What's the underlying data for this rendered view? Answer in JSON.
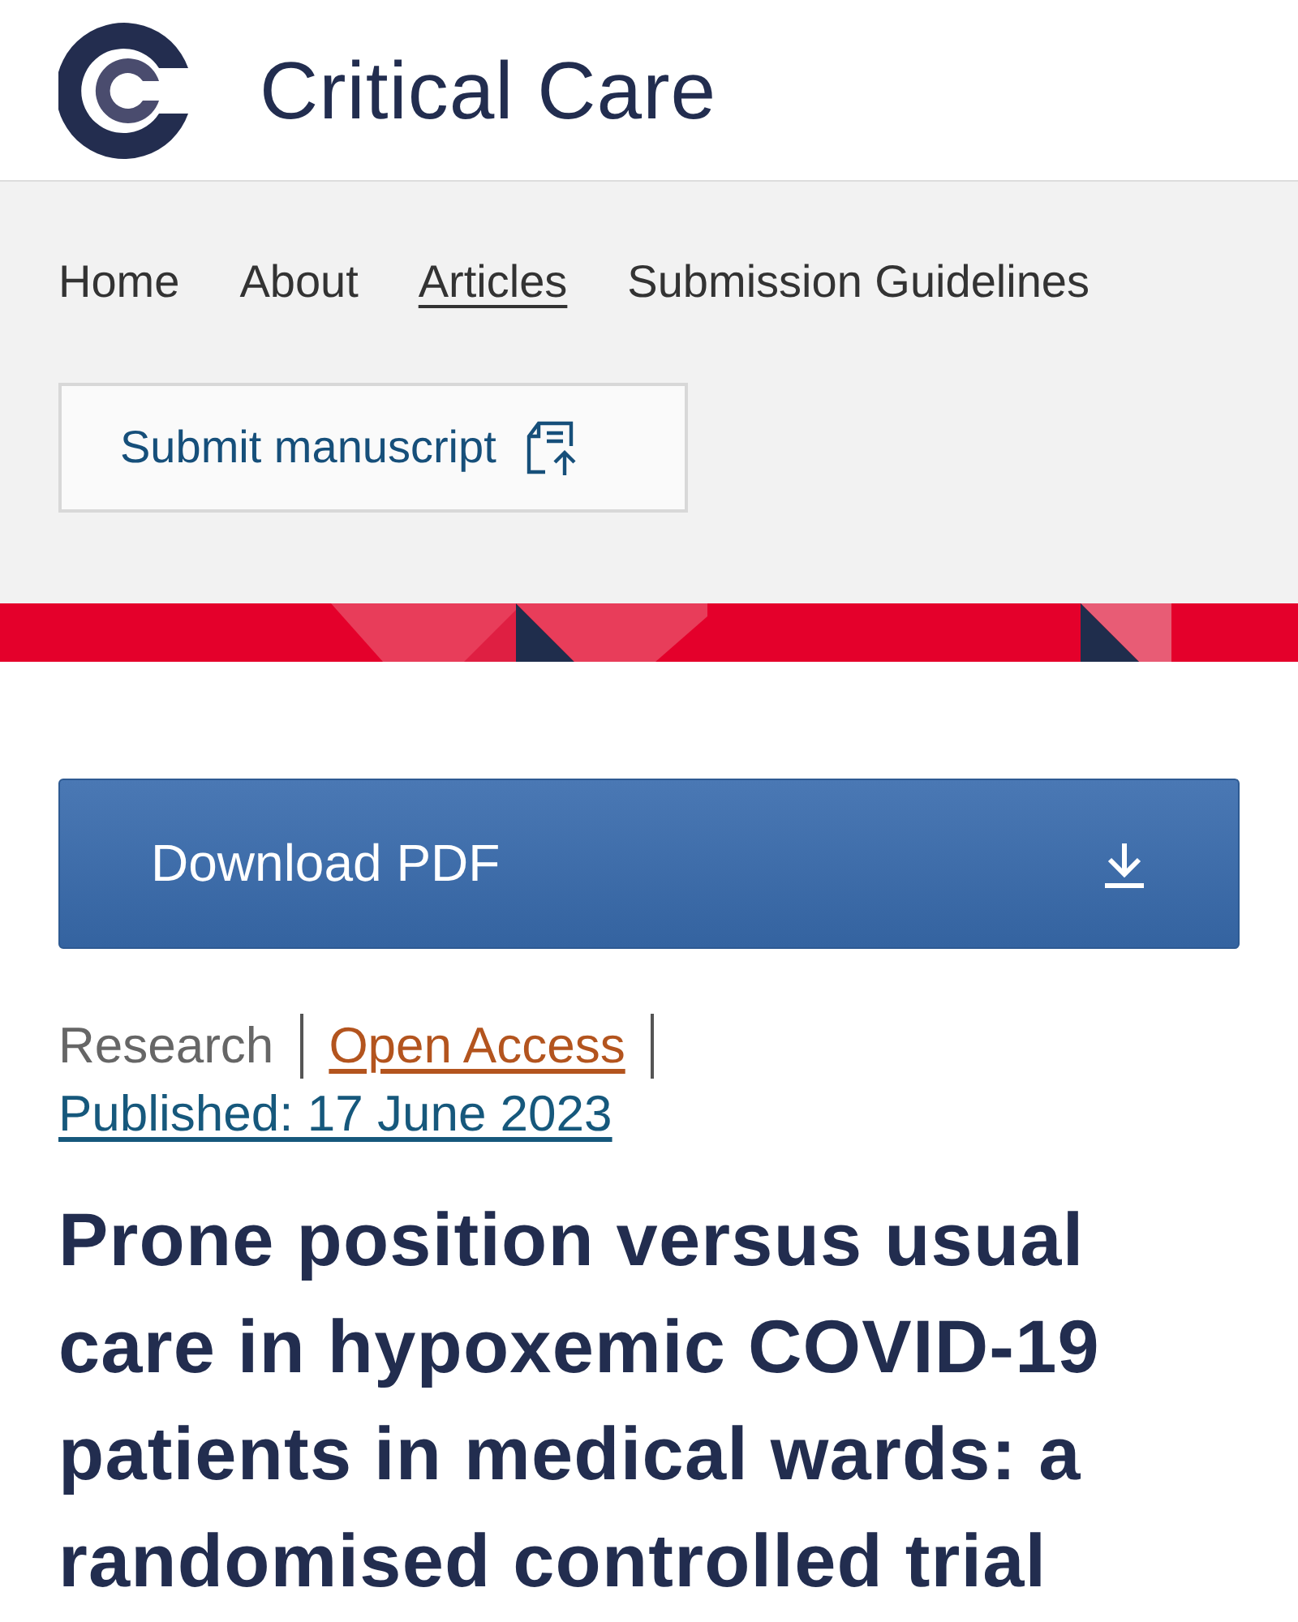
{
  "header": {
    "title": "Critical Care"
  },
  "nav": {
    "items": [
      {
        "label": "Home",
        "selected": false
      },
      {
        "label": "About",
        "selected": false
      },
      {
        "label": "Articles",
        "selected": true
      },
      {
        "label": "Submission Guidelines",
        "selected": false
      }
    ],
    "submit_button": "Submit manuscript"
  },
  "download_button": "Download PDF",
  "article": {
    "type": "Research",
    "access": "Open Access",
    "published": "Published: 17 June 2023",
    "title": "Prone position versus usual care in hypoxemic COVID-19 patients in medical wards: a randomised controlled trial"
  }
}
